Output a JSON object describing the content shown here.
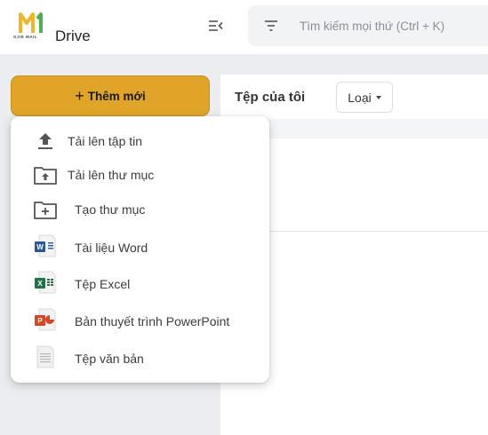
{
  "header": {
    "logo_text": "OJIE MAIL",
    "app_title": "Drive",
    "search": {
      "placeholder": "Tìm kiếm mọi thứ (Ctrl + K)",
      "value": ""
    }
  },
  "sidebar": {
    "new_button_label": "Thêm mới"
  },
  "main": {
    "title": "Tệp của tôi",
    "type_filter_label": "Loại"
  },
  "menu": {
    "items": [
      {
        "label": "Tải lên tập tin",
        "icon": "upload-file-icon"
      },
      {
        "label": "Tải lên thư mục",
        "icon": "upload-folder-icon"
      },
      {
        "label": "Tạo thư mục",
        "icon": "new-folder-icon"
      },
      {
        "label": "Tài liệu Word",
        "icon": "word-icon"
      },
      {
        "label": "Tệp Excel",
        "icon": "excel-icon"
      },
      {
        "label": "Bản thuyết trình PowerPoint",
        "icon": "powerpoint-icon"
      },
      {
        "label": "Tệp văn bản",
        "icon": "text-file-icon"
      }
    ]
  },
  "colors": {
    "accent": "#e0a528",
    "word": "#2b579a",
    "excel": "#217346",
    "powerpoint": "#d24726"
  }
}
